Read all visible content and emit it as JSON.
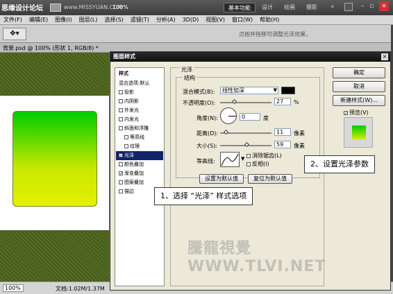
{
  "app_bar": {
    "site_label": "思缘设计论坛",
    "site_url": "www.MISSYUAN.COM",
    "zoom": "100%",
    "workspaces": [
      "基本功能",
      "设计",
      "绘画",
      "摄影"
    ],
    "active_workspace": "基本功能"
  },
  "menu": [
    "文件(F)",
    "编辑(E)",
    "图像(I)",
    "图层(L)",
    "选择(S)",
    "滤镜(T)",
    "分析(A)",
    "3D(D)",
    "视图(V)",
    "窗口(W)",
    "帮助(H)"
  ],
  "options_bar": {
    "hint": "点按并拖移可调整光泽效果。"
  },
  "document": {
    "tab_title": "背景.psd @ 100% (形状 1, RGB/8) *"
  },
  "status": {
    "zoom": "100%",
    "doc_info": "文档:1.02M/1.37M"
  },
  "dialog": {
    "title": "图层样式",
    "styles_header": "样式",
    "style_items": [
      {
        "label": "混合选项:默认",
        "checkbox": false,
        "checked": false,
        "indent": false,
        "selected": false
      },
      {
        "label": "投影",
        "checkbox": true,
        "checked": false,
        "indent": false,
        "selected": false
      },
      {
        "label": "内阴影",
        "checkbox": true,
        "checked": false,
        "indent": false,
        "selected": false
      },
      {
        "label": "外发光",
        "checkbox": true,
        "checked": false,
        "indent": false,
        "selected": false
      },
      {
        "label": "内发光",
        "checkbox": true,
        "checked": false,
        "indent": false,
        "selected": false
      },
      {
        "label": "斜面和浮雕",
        "checkbox": true,
        "checked": false,
        "indent": false,
        "selected": false
      },
      {
        "label": "等高线",
        "checkbox": true,
        "checked": false,
        "indent": true,
        "selected": false
      },
      {
        "label": "纹理",
        "checkbox": true,
        "checked": false,
        "indent": true,
        "selected": false
      },
      {
        "label": "光泽",
        "checkbox": true,
        "checked": true,
        "indent": false,
        "selected": true
      },
      {
        "label": "颜色叠加",
        "checkbox": true,
        "checked": false,
        "indent": false,
        "selected": false
      },
      {
        "label": "渐变叠加",
        "checkbox": true,
        "checked": true,
        "indent": false,
        "selected": false
      },
      {
        "label": "图案叠加",
        "checkbox": true,
        "checked": false,
        "indent": false,
        "selected": false
      },
      {
        "label": "描边",
        "checkbox": true,
        "checked": false,
        "indent": false,
        "selected": false
      }
    ],
    "section_title": "光泽",
    "group_title": "结构",
    "blend_mode_label": "混合模式(B):",
    "blend_mode_value": "线性加深",
    "blend_color": "#000000",
    "opacity_label": "不透明度(O):",
    "opacity_value": "27",
    "opacity_unit": "%",
    "angle_label": "角度(N):",
    "angle_value": "0",
    "angle_unit": "度",
    "distance_label": "距离(D):",
    "distance_value": "11",
    "distance_unit": "像素",
    "size_label": "大小(S):",
    "size_value": "59",
    "size_unit": "像素",
    "contour_label": "等高线:",
    "antialias_label": "消除锯齿(L)",
    "invert_label": "反相(I)",
    "set_default": "设置为默认值",
    "reset_default": "复位为默认值",
    "ok": "确定",
    "cancel": "取消",
    "new_style": "新建样式(W)...",
    "preview_label": "预览(V)",
    "preview_checked": true
  },
  "callouts": {
    "step1": "1、选择 “光泽” 样式选项",
    "step2": "2、设置光泽参数"
  },
  "watermark": "騰龍視覺 WWW.TLVI.NET"
}
